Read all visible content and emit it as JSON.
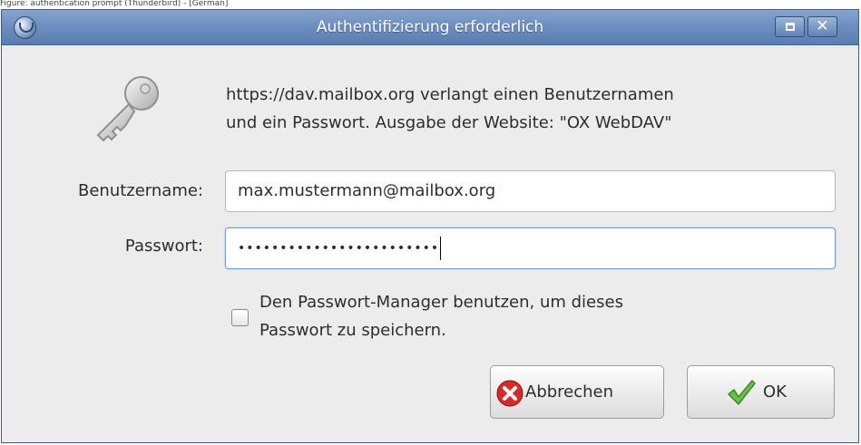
{
  "caption": "Figure: authentication prompt (Thunderbird) - [German]",
  "dialog": {
    "title": "Authentifizierung erforderlich",
    "close_glyph": "✕",
    "message_line1": "https://dav.mailbox.org verlangt einen Benutzernamen",
    "message_line2": "und ein Passwort. Ausgabe der Website: \"OX WebDAV\"",
    "username_label": "Benutzername:",
    "username_value": "max.mustermann@mailbox.org",
    "password_label": "Passwort:",
    "password_value": "••••••••••••••••••••••••",
    "remember_line1": "Den Passwort-Manager benutzen, um dieses",
    "remember_line2": "Passwort zu speichern.",
    "remember_checked": false,
    "cancel_label": "Abbrechen",
    "ok_label": "OK"
  },
  "icons": {
    "app": "thunderbird-icon",
    "dialog": "key-icon",
    "cancel": "cancel-x-icon",
    "ok": "checkmark-icon"
  },
  "colors": {
    "titlebar": "#6b8dbe",
    "dialog_bg": "#ececec",
    "cancel_icon": "#d62b2b",
    "ok_icon": "#6cc04a"
  }
}
